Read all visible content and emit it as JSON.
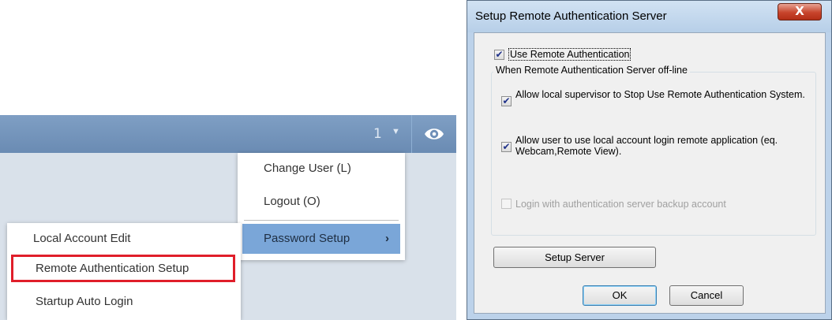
{
  "app": {
    "user_count": "1",
    "icons": {
      "user_dropdown": "caret-down-icon",
      "monitor": "eye-icon",
      "submenu": "chevron-right-icon"
    },
    "main_menu": {
      "items": [
        {
          "label": "Change User (L)"
        },
        {
          "label": "Logout (O)"
        },
        {
          "label": "Password Setup"
        }
      ]
    },
    "sub_menu": {
      "items": [
        {
          "label": "Local Account Edit"
        },
        {
          "label": "Remote Authentication Setup"
        },
        {
          "label": "Startup Auto Login"
        }
      ]
    },
    "colors": {
      "topbar": "#6f8fb8",
      "highlight": "#7aa6d8",
      "annotation": "#e01e2a"
    }
  },
  "dialog": {
    "title": "Setup Remote Authentication Server",
    "close_label": "X",
    "use_remote": {
      "label": "Use Remote Authentication",
      "checked": true
    },
    "group_caption": "When Remote Authentication Server off-line",
    "options": [
      {
        "label": "Allow local supervisor to Stop Use Remote Authentication System.",
        "checked": true,
        "enabled": true
      },
      {
        "label": "Allow user to use local account login remote application (eq. Webcam,Remote View).",
        "checked": true,
        "enabled": true
      },
      {
        "label": "Login with authentication server backup account",
        "checked": false,
        "enabled": false
      }
    ],
    "setup_server_label": "Setup Server",
    "ok_label": "OK",
    "cancel_label": "Cancel"
  }
}
